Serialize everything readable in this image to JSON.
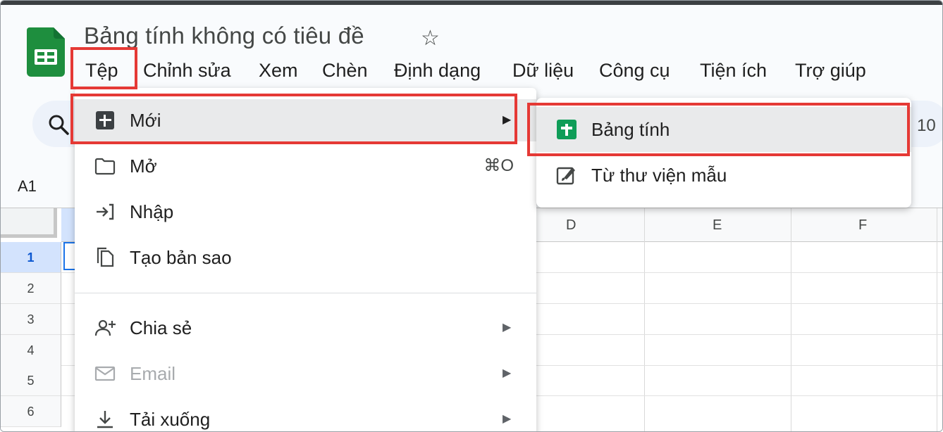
{
  "app": {
    "doc_title": "Bảng tính không có tiêu đề",
    "zoom_partial": "10"
  },
  "menubar": [
    {
      "label": "Tệp"
    },
    {
      "label": "Chỉnh sửa"
    },
    {
      "label": "Xem"
    },
    {
      "label": "Chèn"
    },
    {
      "label": "Định dạng"
    },
    {
      "label": "Dữ liệu"
    },
    {
      "label": "Công cụ"
    },
    {
      "label": "Tiện ích"
    },
    {
      "label": "Trợ giúp"
    }
  ],
  "namebox": "A1",
  "columns": [
    "D",
    "E",
    "F"
  ],
  "rows": [
    "1",
    "2",
    "3",
    "4",
    "5",
    "6"
  ],
  "file_menu": {
    "new": {
      "label": "Mới",
      "icon": "new-sheet-icon"
    },
    "open": {
      "label": "Mở",
      "shortcut": "⌘O",
      "icon": "folder-icon"
    },
    "import": {
      "label": "Nhập",
      "icon": "import-icon"
    },
    "copy": {
      "label": "Tạo bản sao",
      "icon": "copy-icon"
    },
    "share": {
      "label": "Chia sẻ",
      "icon": "share-person-icon"
    },
    "email": {
      "label": "Email",
      "icon": "mail-icon"
    },
    "download": {
      "label": "Tải xuống",
      "icon": "download-icon"
    }
  },
  "new_submenu": {
    "spreadsheet": {
      "label": "Bảng tính",
      "icon": "sheets-icon"
    },
    "template": {
      "label": "Từ thư viện mẫu",
      "icon": "template-icon"
    }
  },
  "colors": {
    "highlight": "#e53935",
    "sheets_green": "#0f9d58",
    "selection": "#1a73e8"
  }
}
